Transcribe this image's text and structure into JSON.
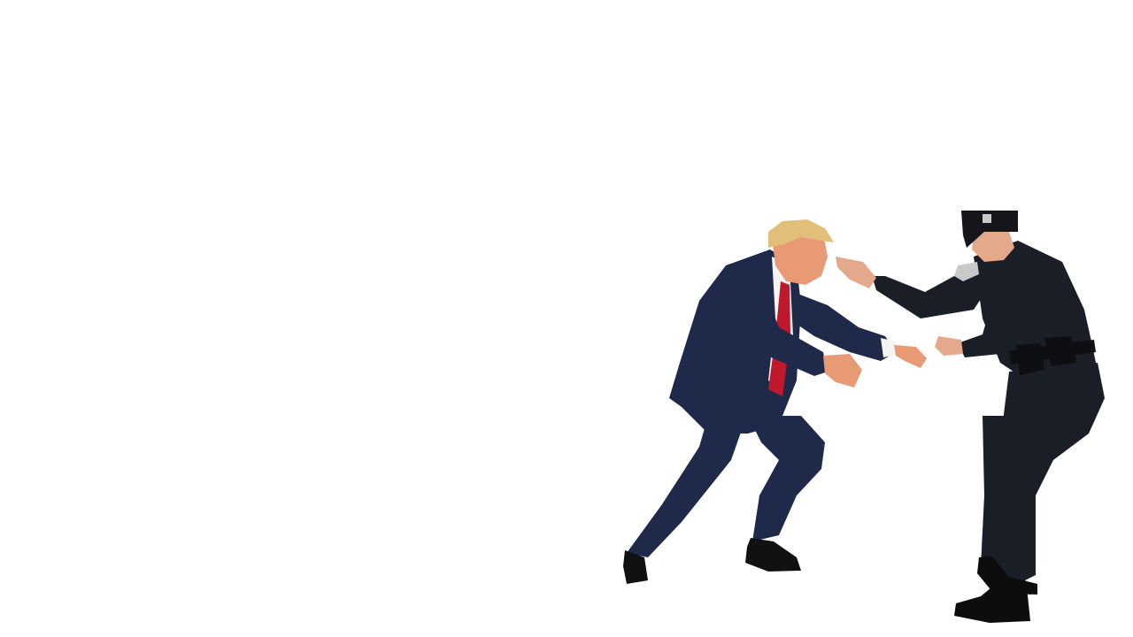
{
  "scene": {
    "background_color": "#ffffff",
    "figures": [
      {
        "name": "man-in-suit",
        "hair_color": "#e2bf78",
        "suit_color": "#1f2a4a",
        "tie_color": "#c0182c",
        "shirt_color": "#f4f4f4",
        "skin_color": "#e79a74",
        "shoe_color": "#111111"
      },
      {
        "name": "police-officer",
        "uniform_color": "#1a1e27",
        "cap_color": "#14161c",
        "badge_color": "#c9c9c9",
        "belt_color": "#0e0f12",
        "skin_color": "#e4a98a",
        "shoe_color": "#0d0d0d"
      }
    ]
  }
}
